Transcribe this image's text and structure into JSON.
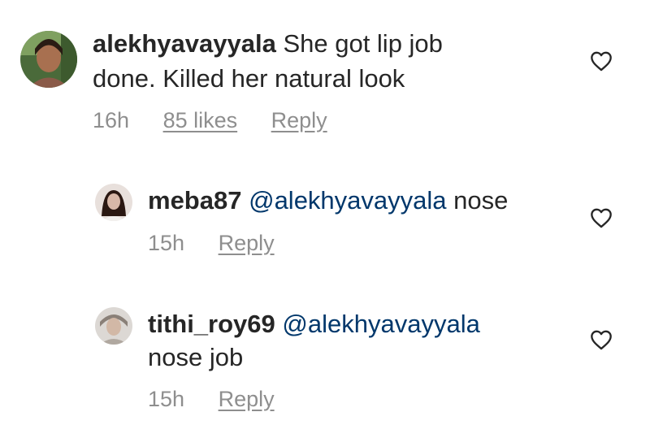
{
  "comments": [
    {
      "username": "alekhyavayyala",
      "text_line1": "She got lip job",
      "text_line2": "done. Killed her natural look",
      "time": "16h",
      "likes": "85 likes",
      "reply_label": "Reply"
    },
    {
      "username": "meba87",
      "mention": "@alekhyavayyala",
      "text": "nose",
      "time": "15h",
      "reply_label": "Reply"
    },
    {
      "username": "tithi_roy69",
      "mention": "@alekhyavayyala",
      "text_line2": "nose job",
      "time": "15h",
      "reply_label": "Reply"
    }
  ],
  "icons": {
    "like": "heart-outline-icon"
  }
}
